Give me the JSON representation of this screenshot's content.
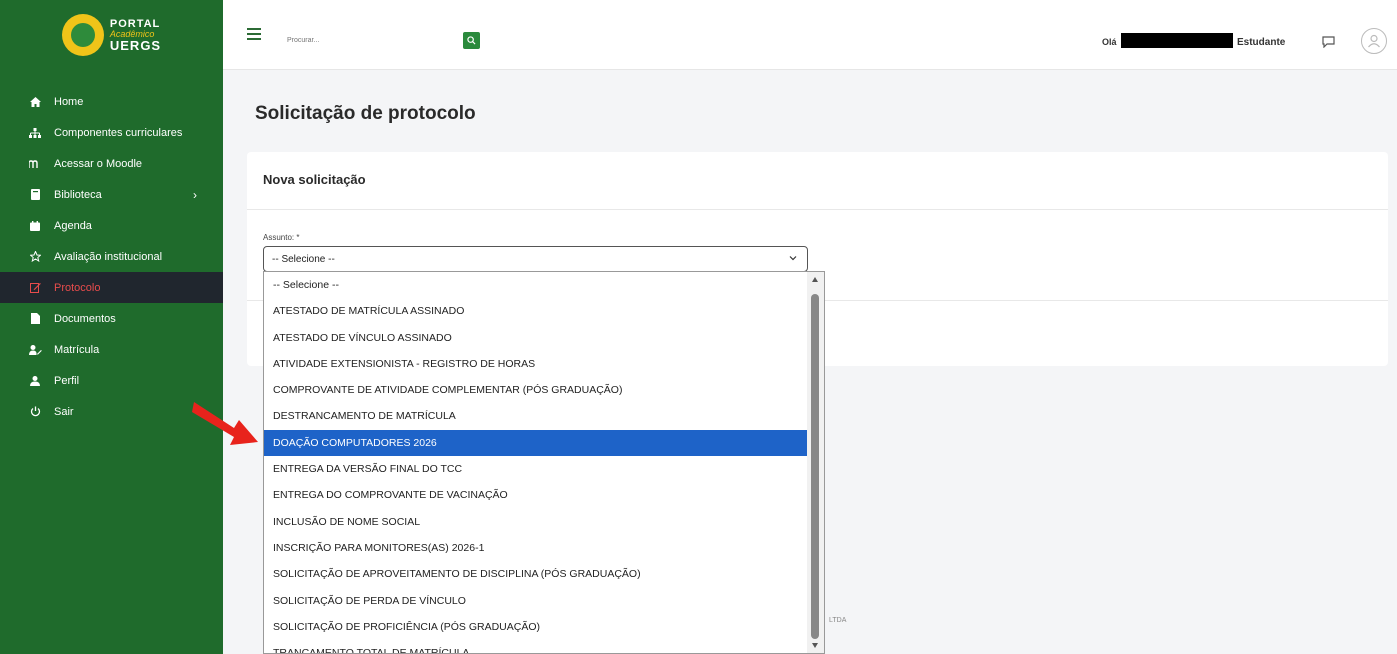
{
  "sidebar": {
    "logo": {
      "portal": "PORTAL",
      "academico": "Acadêmico",
      "uergs": "UERGS"
    },
    "items": [
      {
        "label": "Home",
        "icon": "home-icon"
      },
      {
        "label": "Componentes curriculares",
        "icon": "sitemap-icon"
      },
      {
        "label": "Acessar o Moodle",
        "icon": "moodle-icon"
      },
      {
        "label": "Biblioteca",
        "icon": "book-icon",
        "chevron": "›"
      },
      {
        "label": "Agenda",
        "icon": "calendar-icon"
      },
      {
        "label": "Avaliação institucional",
        "icon": "star-icon"
      },
      {
        "label": "Protocolo",
        "icon": "edit-icon",
        "active": true
      },
      {
        "label": "Documentos",
        "icon": "document-icon"
      },
      {
        "label": "Matrícula",
        "icon": "user-edit-icon"
      },
      {
        "label": "Perfil",
        "icon": "user-icon"
      },
      {
        "label": "Sair",
        "icon": "power-icon"
      }
    ]
  },
  "topbar": {
    "search_placeholder": "Procurar...",
    "greeting": "Olá",
    "role": "Estudante"
  },
  "main": {
    "page_title": "Solicitação de protocolo",
    "card_title": "Nova solicitação",
    "field_label": "Assunto: *",
    "select_value": "-- Selecione --"
  },
  "dropdown": {
    "options": [
      "-- Selecione --",
      "ATESTADO DE MATRÍCULA ASSINADO",
      "ATESTADO DE VÍNCULO ASSINADO",
      "ATIVIDADE EXTENSIONISTA - REGISTRO DE HORAS",
      "COMPROVANTE DE ATIVIDADE COMPLEMENTAR (PÓS GRADUAÇÃO)",
      "DESTRANCAMENTO DE MATRÍCULA",
      "DOAÇÃO COMPUTADORES 2026",
      "ENTREGA DA VERSÃO FINAL DO TCC",
      "ENTREGA DO COMPROVANTE DE VACINAÇÃO",
      "INCLUSÃO DE NOME SOCIAL",
      "INSCRIÇÃO PARA MONITORES(AS) 2026-1",
      "SOLICITAÇÃO DE APROVEITAMENTO DE DISCIPLINA (PÓS GRADUAÇÃO)",
      "SOLICITAÇÃO DE PERDA DE VÍNCULO",
      "SOLICITAÇÃO DE PROFICIÊNCIA (PÓS GRADUAÇÃO)",
      "TRANCAMENTO TOTAL DE MATRÍCULA"
    ],
    "highlighted": "DOAÇÃO COMPUTADORES 2026"
  },
  "footer": {
    "text": "LTDA"
  },
  "colors": {
    "sidebar": "#1f6b2c",
    "active_bg": "#20262e",
    "active_text": "#e84c4c",
    "highlight": "#1e63c8",
    "arrow": "#e8231c"
  }
}
